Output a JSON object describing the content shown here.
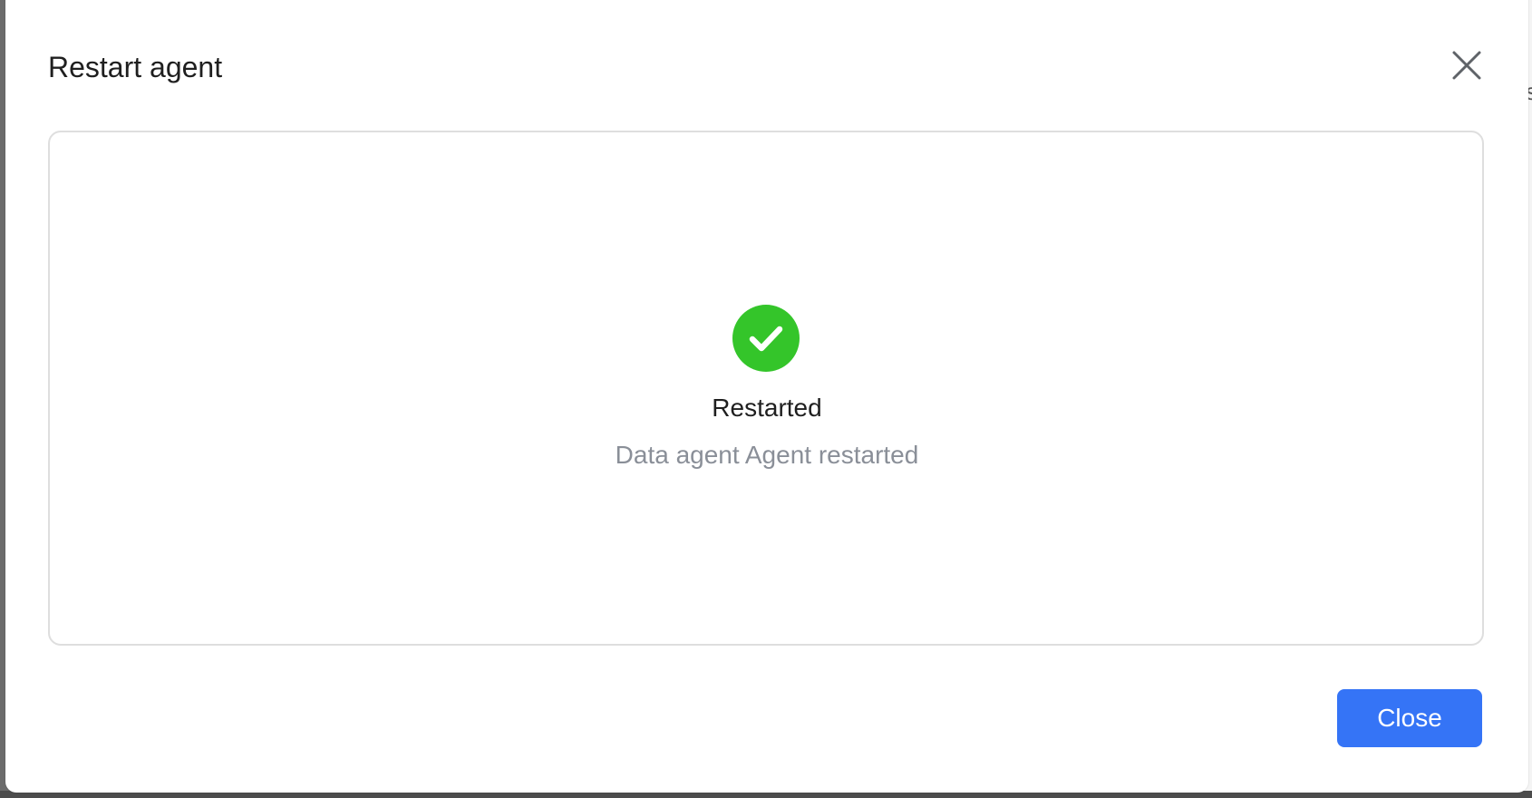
{
  "dialog": {
    "title": "Restart agent",
    "close_icon": "close-icon"
  },
  "result": {
    "icon": "check-circle-icon",
    "title": "Restarted",
    "description": "Data agent Agent restarted",
    "success_color": "#34c52a"
  },
  "footer": {
    "close_label": "Close",
    "accent_color": "#3574f6"
  },
  "backdrop": {
    "partial_text": "s"
  }
}
